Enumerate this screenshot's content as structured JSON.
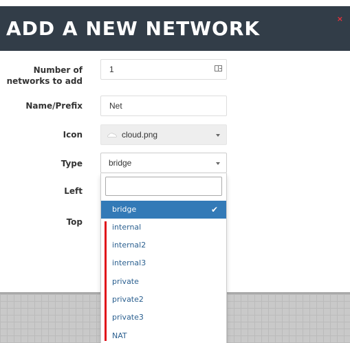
{
  "modal": {
    "title": "ADD A NEW NETWORK",
    "close_symbol": "×"
  },
  "form": {
    "count_label_line1": "Number of",
    "count_label_line2": "networks to add",
    "count_value": "1",
    "name_label": "Name/Prefix",
    "name_value": "Net",
    "icon_label": "Icon",
    "icon_value": "cloud.png",
    "type_label": "Type",
    "type_value": "bridge",
    "left_label": "Left",
    "top_label": "Top"
  },
  "dropdown": {
    "search_value": "",
    "options": [
      "bridge",
      "internal",
      "internal2",
      "internal3",
      "private",
      "private2",
      "private3",
      "NAT"
    ],
    "selected": "bridge",
    "check_symbol": "✔"
  },
  "icons": [
    "close-icon",
    "stepper-icon",
    "cloud-icon",
    "chevron-down-icon",
    "check-icon"
  ],
  "colors": {
    "header_bg": "#323d48",
    "close": "#e8323c",
    "selected_bg": "#337ab7",
    "option_text": "#2a5f8f",
    "highlight_bar": "#e0101a"
  }
}
